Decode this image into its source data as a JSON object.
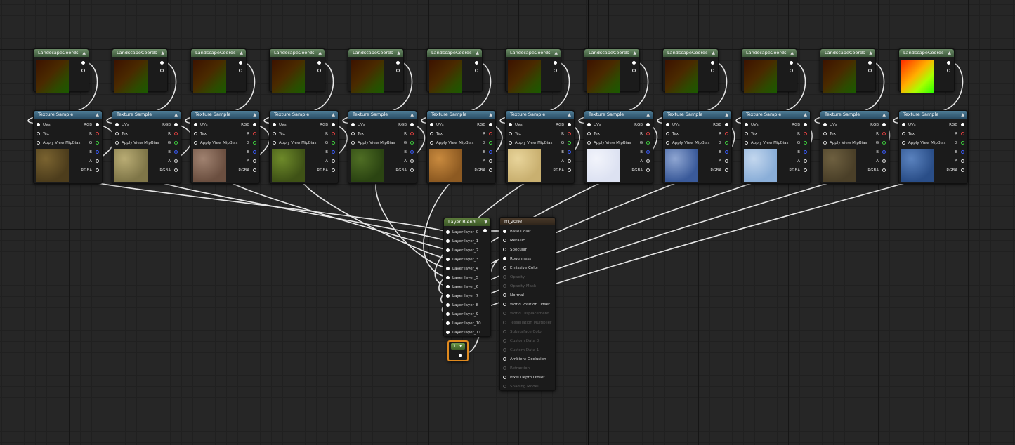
{
  "graph": {
    "coords_label": "LandscapeCoords",
    "texture_sample": {
      "title": "Texture Sample",
      "inputs": [
        "UVs",
        "Tex",
        "Apply View MipBias"
      ],
      "outputs": [
        "RGB",
        "R",
        "G",
        "B",
        "A",
        "RGBA"
      ]
    },
    "texture_colors": [
      {
        "a": "#7a6330",
        "b": "#4d3d1c"
      },
      {
        "a": "#b9ac74",
        "b": "#7f7648"
      },
      {
        "a": "#a08270",
        "b": "#6b4f40"
      },
      {
        "a": "#6e8a2a",
        "b": "#3f5216"
      },
      {
        "a": "#4f6e24",
        "b": "#2b4412"
      },
      {
        "a": "#c98a3e",
        "b": "#8d5a22"
      },
      {
        "a": "#e8d49a",
        "b": "#c9b070"
      },
      {
        "a": "#f2f4fb",
        "b": "#dde2f2"
      },
      {
        "a": "#8fa6d2",
        "b": "#3a5a9a"
      },
      {
        "a": "#c3d7ee",
        "b": "#8aaed8"
      },
      {
        "a": "#6e6040",
        "b": "#4a3f28"
      },
      {
        "a": "#5a82be",
        "b": "#2a4e88"
      }
    ],
    "layer_blend": {
      "title": "Layer Blend",
      "layers": [
        "Layer layer_0",
        "Layer layer_1",
        "Layer layer_2",
        "Layer layer_3",
        "Layer layer_4",
        "Layer layer_5",
        "Layer layer_6",
        "Layer layer_7",
        "Layer layer_8",
        "Layer layer_9",
        "Layer layer_10",
        "Layer layer_11"
      ]
    },
    "material": {
      "title": "m_zone",
      "pins": [
        {
          "label": "Base Color",
          "active": true
        },
        {
          "label": "Metallic",
          "active": true
        },
        {
          "label": "Specular",
          "active": true
        },
        {
          "label": "Roughness",
          "active": true
        },
        {
          "label": "Emissive Color",
          "active": true
        },
        {
          "label": "Opacity",
          "active": false
        },
        {
          "label": "Opacity Mask",
          "active": false
        },
        {
          "label": "Normal",
          "active": true
        },
        {
          "label": "World Position Offset",
          "active": true
        },
        {
          "label": "World Displacement",
          "active": false
        },
        {
          "label": "Tessellation Multiplier",
          "active": false
        },
        {
          "label": "Subsurface Color",
          "active": false
        },
        {
          "label": "Custom Data 0",
          "active": false
        },
        {
          "label": "Custom Data 1",
          "active": false
        },
        {
          "label": "Ambient Occlusion",
          "active": true
        },
        {
          "label": "Refraction",
          "active": false
        },
        {
          "label": "Pixel Depth Offset",
          "active": true
        },
        {
          "label": "Shading Model",
          "active": false
        }
      ]
    },
    "constant": {
      "value": "1"
    }
  }
}
